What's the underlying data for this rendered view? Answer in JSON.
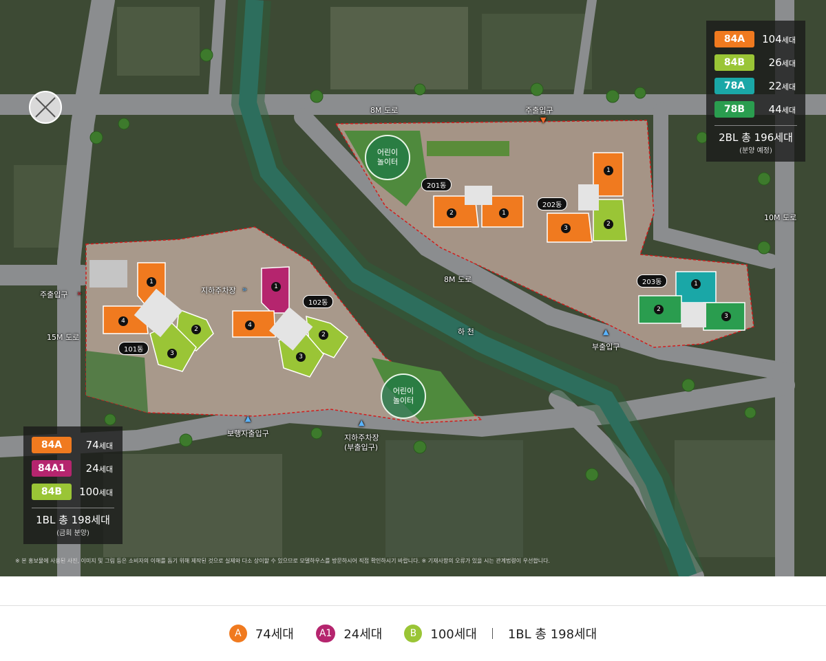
{
  "map": {
    "roads": {
      "road_8m_top": "8M 도로",
      "road_8m_mid": "8M 도로",
      "road_10m": "10M 도로",
      "road_15m": "15M 도로",
      "stream": "하 천"
    },
    "entrances": {
      "main_top": "주출입구",
      "main_left": "주출입구",
      "sub_right": "부출입구",
      "pedestrian": "보행자출입구",
      "underground_sub_line1": "지하주차장",
      "underground_sub_line2": "(부출입구)",
      "underground_parking": "지하주차장"
    },
    "buildings": {
      "b101": "101동",
      "b102": "102동",
      "b201": "201동",
      "b202": "202동",
      "b203": "203동"
    },
    "playgrounds": {
      "top_line1": "어린이",
      "top_line2": "놀이터",
      "bottom_line1": "어린이",
      "bottom_line2": "놀이터"
    },
    "unit_numbers": {
      "n1": "1",
      "n2": "2",
      "n3": "3",
      "n4": "4"
    }
  },
  "legend_2bl": {
    "rows": [
      {
        "type": "84A",
        "count": "104",
        "unit": "세대",
        "color": "#f07a1f"
      },
      {
        "type": "84B",
        "count": "26",
        "unit": "세대",
        "color": "#9ac536"
      },
      {
        "type": "78A",
        "count": "22",
        "unit": "세대",
        "color": "#1aa7a7"
      },
      {
        "type": "78B",
        "count": "44",
        "unit": "세대",
        "color": "#2a9d4f"
      }
    ],
    "total": "2BL 총 196세대",
    "note": "(분양 예정)"
  },
  "legend_1bl": {
    "rows": [
      {
        "type": "84A",
        "count": "74",
        "unit": "세대",
        "color": "#f07a1f"
      },
      {
        "type": "84A1",
        "count": "24",
        "unit": "세대",
        "color": "#b5256e"
      },
      {
        "type": "84B",
        "count": "100",
        "unit": "세대",
        "color": "#9ac536"
      }
    ],
    "total": "1BL 총 198세대",
    "note": "(금회 분양)"
  },
  "notice": "※ 본 홍보물에 사용된 사진, 이미지 및 그림 등은 소비자의 이해를 돕기 위해 제작된 것으로 실제와 다소 상이할 수 있으므로 모델하우스를 방문하시어 직접 확인하시기 바랍니다. ※ 기재사항의 오류가 있을 시는 관계법령이 우선합니다.",
  "summary": {
    "items": [
      {
        "badge": "A",
        "text": "74세대",
        "color": "#f07a1f"
      },
      {
        "badge": "A1",
        "text": "24세대",
        "color": "#b5256e"
      },
      {
        "badge": "B",
        "text": "100세대",
        "color": "#9ac536"
      }
    ],
    "total": "1BL 총 198세대"
  }
}
